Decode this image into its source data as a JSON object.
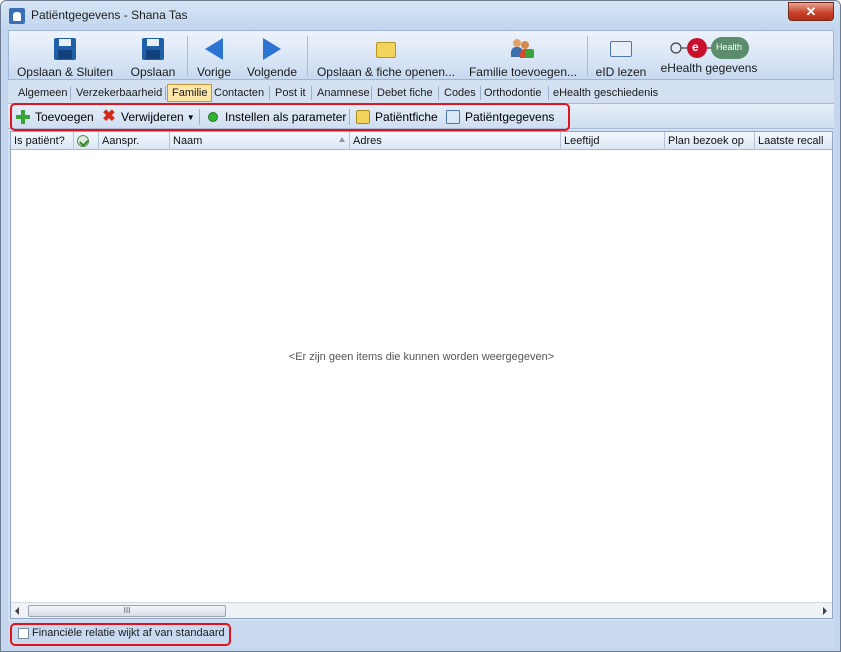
{
  "window": {
    "title": "Patiëntgegevens - Shana Tas",
    "close_label": "✕"
  },
  "toolbar": {
    "save_close": "Opslaan & Sluiten",
    "save": "Opslaan",
    "previous": "Vorige",
    "next": "Volgende",
    "save_open_card": "Opslaan & fiche openen...",
    "add_family": "Familie toevoegen...",
    "read_eid": "eID lezen",
    "ehealth_data": "eHealth gegevens",
    "ehealth_logo_text": "Health",
    "ehealth_logo_e": "e"
  },
  "tabs": [
    {
      "label": "Algemeen"
    },
    {
      "label": "Verzekerbaarheid"
    },
    {
      "label": "Familie"
    },
    {
      "label": "Contacten"
    },
    {
      "label": "Post it"
    },
    {
      "label": "Anamnese"
    },
    {
      "label": "Debet fiche"
    },
    {
      "label": "Codes"
    },
    {
      "label": "Orthodontie"
    },
    {
      "label": "eHealth geschiedenis"
    }
  ],
  "active_tab": "Familie",
  "subtoolbar": {
    "add": "Toevoegen",
    "remove": "Verwijderen",
    "set_as_param": "Instellen als parameter",
    "patient_card": "Patiëntfiche",
    "patient_data": "Patiëntgegevens"
  },
  "grid": {
    "columns": [
      "Is patiënt?",
      "",
      "Aanspr.",
      "Naam",
      "Adres",
      "Leeftijd",
      "Plan bezoek op",
      "Laatste recall"
    ],
    "empty_message": "<Er zijn geen items die kunnen worden weergegeven>",
    "scroll_grip": "III"
  },
  "footer": {
    "financial_relation_label": "Financiële relatie wijkt af van standaard",
    "financial_relation_checked": false
  },
  "colors": {
    "highlight": "#e0141e",
    "accent_blue": "#2b74d2",
    "ehealth_red": "#c8102e",
    "ehealth_green": "#5b8c6b"
  }
}
